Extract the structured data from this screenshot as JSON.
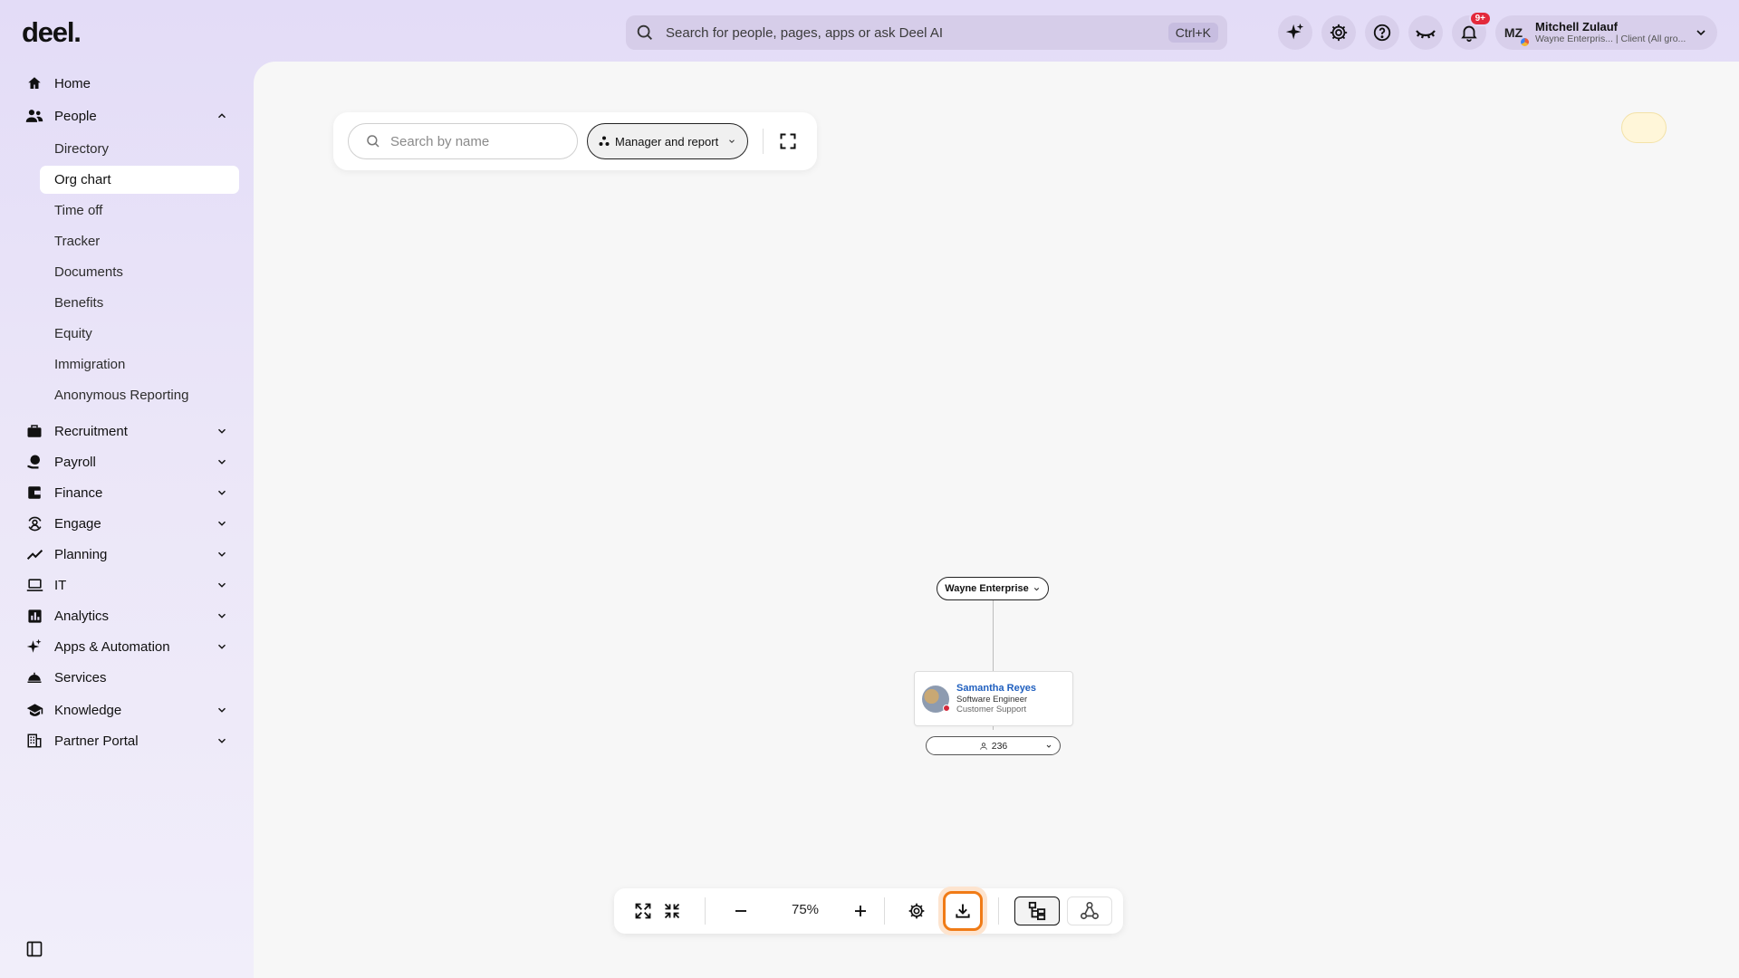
{
  "app": {
    "logo": "deel.",
    "search_placeholder": "Search for people, pages, apps or ask Deel AI",
    "search_shortcut": "Ctrl+K",
    "notifications_badge": "9+",
    "user": {
      "initials": "MZ",
      "name": "Mitchell Zulauf",
      "subtitle": "Wayne Enterpris... | Client (All gro..."
    }
  },
  "sidebar": {
    "items": [
      {
        "label": "Home",
        "icon": "home-icon"
      },
      {
        "label": "People",
        "icon": "people-icon",
        "expanded": true,
        "children": [
          "Directory",
          "Org chart",
          "Time off",
          "Tracker",
          "Documents",
          "Benefits",
          "Equity",
          "Immigration",
          "Anonymous Reporting"
        ],
        "active_child": "Org chart"
      },
      {
        "label": "Recruitment",
        "icon": "briefcase-icon"
      },
      {
        "label": "Payroll",
        "icon": "payroll-icon"
      },
      {
        "label": "Finance",
        "icon": "wallet-icon"
      },
      {
        "label": "Engage",
        "icon": "engage-icon"
      },
      {
        "label": "Planning",
        "icon": "trend-icon"
      },
      {
        "label": "IT",
        "icon": "laptop-icon"
      },
      {
        "label": "Analytics",
        "icon": "analytics-icon"
      },
      {
        "label": "Apps & Automation",
        "icon": "sparkle-icon"
      },
      {
        "label": "Services",
        "icon": "services-icon"
      },
      {
        "label": "Knowledge",
        "icon": "graduation-cap-icon"
      },
      {
        "label": "Partner Portal",
        "icon": "building-icon"
      }
    ]
  },
  "toolbar": {
    "name_search_placeholder": "Search by name",
    "view_mode": "Manager and report"
  },
  "org_chart": {
    "root": "Wayne Enterprise",
    "person": {
      "name": "Samantha Reyes",
      "title": "Software Engineer",
      "department": "Customer Support",
      "reports_count": "236"
    }
  },
  "controls": {
    "zoom": "75%"
  },
  "colors": {
    "accent_orange": "#f07b16",
    "link_blue": "#1f5fbf",
    "badge_red": "#e3293b",
    "sidebar_bg": "#e3dcf7"
  }
}
